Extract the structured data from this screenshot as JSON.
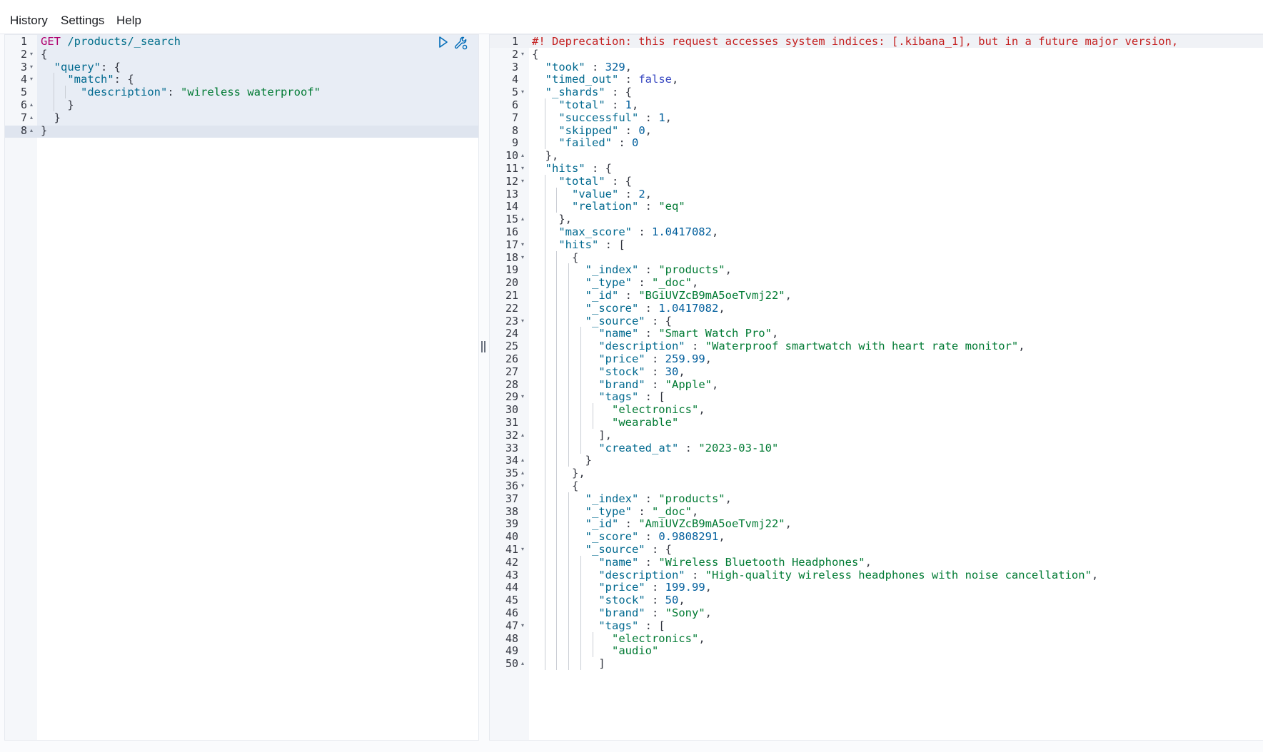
{
  "menu": {
    "history": "History",
    "settings": "Settings",
    "help": "Help"
  },
  "request": {
    "lines": [
      [
        [
          "m",
          "GET"
        ],
        [
          "p",
          " "
        ],
        [
          "u",
          "/products/_search"
        ]
      ],
      [
        [
          "p",
          "{"
        ]
      ],
      [
        [
          "p",
          "  "
        ],
        [
          "k",
          "\"query\""
        ],
        [
          "p",
          ": {"
        ]
      ],
      [
        [
          "p",
          "    "
        ],
        [
          "k",
          "\"match\""
        ],
        [
          "p",
          ": {"
        ]
      ],
      [
        [
          "p",
          "      "
        ],
        [
          "k",
          "\"description\""
        ],
        [
          "p",
          ": "
        ],
        [
          "s",
          "\"wireless waterproof\""
        ]
      ],
      [
        [
          "p",
          "    }"
        ]
      ],
      [
        [
          "p",
          "  }"
        ]
      ],
      [
        [
          "p",
          "}"
        ]
      ]
    ],
    "folds": {
      "2": "▾",
      "3": "▾",
      "4": "▾",
      "6": "▴",
      "7": "▴",
      "8": "▴"
    }
  },
  "response": {
    "lines": [
      [
        [
          "w",
          "#! Deprecation: this request accesses system indices: [.kibana_1], but in a future major version,"
        ]
      ],
      [
        [
          "p",
          "{"
        ]
      ],
      [
        [
          "p",
          "  "
        ],
        [
          "k",
          "\"took\""
        ],
        [
          "p",
          " : "
        ],
        [
          "n",
          "329"
        ],
        [
          "p",
          ","
        ]
      ],
      [
        [
          "p",
          "  "
        ],
        [
          "k",
          "\"timed_out\""
        ],
        [
          "p",
          " : "
        ],
        [
          "b",
          "false"
        ],
        [
          "p",
          ","
        ]
      ],
      [
        [
          "p",
          "  "
        ],
        [
          "k",
          "\"_shards\""
        ],
        [
          "p",
          " : {"
        ]
      ],
      [
        [
          "p",
          "    "
        ],
        [
          "k",
          "\"total\""
        ],
        [
          "p",
          " : "
        ],
        [
          "n",
          "1"
        ],
        [
          "p",
          ","
        ]
      ],
      [
        [
          "p",
          "    "
        ],
        [
          "k",
          "\"successful\""
        ],
        [
          "p",
          " : "
        ],
        [
          "n",
          "1"
        ],
        [
          "p",
          ","
        ]
      ],
      [
        [
          "p",
          "    "
        ],
        [
          "k",
          "\"skipped\""
        ],
        [
          "p",
          " : "
        ],
        [
          "n",
          "0"
        ],
        [
          "p",
          ","
        ]
      ],
      [
        [
          "p",
          "    "
        ],
        [
          "k",
          "\"failed\""
        ],
        [
          "p",
          " : "
        ],
        [
          "n",
          "0"
        ]
      ],
      [
        [
          "p",
          "  },"
        ]
      ],
      [
        [
          "p",
          "  "
        ],
        [
          "k",
          "\"hits\""
        ],
        [
          "p",
          " : {"
        ]
      ],
      [
        [
          "p",
          "    "
        ],
        [
          "k",
          "\"total\""
        ],
        [
          "p",
          " : {"
        ]
      ],
      [
        [
          "p",
          "      "
        ],
        [
          "k",
          "\"value\""
        ],
        [
          "p",
          " : "
        ],
        [
          "n",
          "2"
        ],
        [
          "p",
          ","
        ]
      ],
      [
        [
          "p",
          "      "
        ],
        [
          "k",
          "\"relation\""
        ],
        [
          "p",
          " : "
        ],
        [
          "s",
          "\"eq\""
        ]
      ],
      [
        [
          "p",
          "    },"
        ]
      ],
      [
        [
          "p",
          "    "
        ],
        [
          "k",
          "\"max_score\""
        ],
        [
          "p",
          " : "
        ],
        [
          "n",
          "1.0417082"
        ],
        [
          "p",
          ","
        ]
      ],
      [
        [
          "p",
          "    "
        ],
        [
          "k",
          "\"hits\""
        ],
        [
          "p",
          " : ["
        ]
      ],
      [
        [
          "p",
          "      {"
        ]
      ],
      [
        [
          "p",
          "        "
        ],
        [
          "k",
          "\"_index\""
        ],
        [
          "p",
          " : "
        ],
        [
          "s",
          "\"products\""
        ],
        [
          "p",
          ","
        ]
      ],
      [
        [
          "p",
          "        "
        ],
        [
          "k",
          "\"_type\""
        ],
        [
          "p",
          " : "
        ],
        [
          "s",
          "\"_doc\""
        ],
        [
          "p",
          ","
        ]
      ],
      [
        [
          "p",
          "        "
        ],
        [
          "k",
          "\"_id\""
        ],
        [
          "p",
          " : "
        ],
        [
          "s",
          "\"BGiUVZcB9mA5oeTvmj22\""
        ],
        [
          "p",
          ","
        ]
      ],
      [
        [
          "p",
          "        "
        ],
        [
          "k",
          "\"_score\""
        ],
        [
          "p",
          " : "
        ],
        [
          "n",
          "1.0417082"
        ],
        [
          "p",
          ","
        ]
      ],
      [
        [
          "p",
          "        "
        ],
        [
          "k",
          "\"_source\""
        ],
        [
          "p",
          " : {"
        ]
      ],
      [
        [
          "p",
          "          "
        ],
        [
          "k",
          "\"name\""
        ],
        [
          "p",
          " : "
        ],
        [
          "s",
          "\"Smart Watch Pro\""
        ],
        [
          "p",
          ","
        ]
      ],
      [
        [
          "p",
          "          "
        ],
        [
          "k",
          "\"description\""
        ],
        [
          "p",
          " : "
        ],
        [
          "s",
          "\"Waterproof smartwatch with heart rate monitor\""
        ],
        [
          "p",
          ","
        ]
      ],
      [
        [
          "p",
          "          "
        ],
        [
          "k",
          "\"price\""
        ],
        [
          "p",
          " : "
        ],
        [
          "n",
          "259.99"
        ],
        [
          "p",
          ","
        ]
      ],
      [
        [
          "p",
          "          "
        ],
        [
          "k",
          "\"stock\""
        ],
        [
          "p",
          " : "
        ],
        [
          "n",
          "30"
        ],
        [
          "p",
          ","
        ]
      ],
      [
        [
          "p",
          "          "
        ],
        [
          "k",
          "\"brand\""
        ],
        [
          "p",
          " : "
        ],
        [
          "s",
          "\"Apple\""
        ],
        [
          "p",
          ","
        ]
      ],
      [
        [
          "p",
          "          "
        ],
        [
          "k",
          "\"tags\""
        ],
        [
          "p",
          " : ["
        ]
      ],
      [
        [
          "p",
          "            "
        ],
        [
          "s",
          "\"electronics\""
        ],
        [
          "p",
          ","
        ]
      ],
      [
        [
          "p",
          "            "
        ],
        [
          "s",
          "\"wearable\""
        ]
      ],
      [
        [
          "p",
          "          ],"
        ]
      ],
      [
        [
          "p",
          "          "
        ],
        [
          "k",
          "\"created_at\""
        ],
        [
          "p",
          " : "
        ],
        [
          "s",
          "\"2023-03-10\""
        ]
      ],
      [
        [
          "p",
          "        }"
        ]
      ],
      [
        [
          "p",
          "      },"
        ]
      ],
      [
        [
          "p",
          "      {"
        ]
      ],
      [
        [
          "p",
          "        "
        ],
        [
          "k",
          "\"_index\""
        ],
        [
          "p",
          " : "
        ],
        [
          "s",
          "\"products\""
        ],
        [
          "p",
          ","
        ]
      ],
      [
        [
          "p",
          "        "
        ],
        [
          "k",
          "\"_type\""
        ],
        [
          "p",
          " : "
        ],
        [
          "s",
          "\"_doc\""
        ],
        [
          "p",
          ","
        ]
      ],
      [
        [
          "p",
          "        "
        ],
        [
          "k",
          "\"_id\""
        ],
        [
          "p",
          " : "
        ],
        [
          "s",
          "\"AmiUVZcB9mA5oeTvmj22\""
        ],
        [
          "p",
          ","
        ]
      ],
      [
        [
          "p",
          "        "
        ],
        [
          "k",
          "\"_score\""
        ],
        [
          "p",
          " : "
        ],
        [
          "n",
          "0.9808291"
        ],
        [
          "p",
          ","
        ]
      ],
      [
        [
          "p",
          "        "
        ],
        [
          "k",
          "\"_source\""
        ],
        [
          "p",
          " : {"
        ]
      ],
      [
        [
          "p",
          "          "
        ],
        [
          "k",
          "\"name\""
        ],
        [
          "p",
          " : "
        ],
        [
          "s",
          "\"Wireless Bluetooth Headphones\""
        ],
        [
          "p",
          ","
        ]
      ],
      [
        [
          "p",
          "          "
        ],
        [
          "k",
          "\"description\""
        ],
        [
          "p",
          " : "
        ],
        [
          "s",
          "\"High-quality wireless headphones with noise cancellation\""
        ],
        [
          "p",
          ","
        ]
      ],
      [
        [
          "p",
          "          "
        ],
        [
          "k",
          "\"price\""
        ],
        [
          "p",
          " : "
        ],
        [
          "n",
          "199.99"
        ],
        [
          "p",
          ","
        ]
      ],
      [
        [
          "p",
          "          "
        ],
        [
          "k",
          "\"stock\""
        ],
        [
          "p",
          " : "
        ],
        [
          "n",
          "50"
        ],
        [
          "p",
          ","
        ]
      ],
      [
        [
          "p",
          "          "
        ],
        [
          "k",
          "\"brand\""
        ],
        [
          "p",
          " : "
        ],
        [
          "s",
          "\"Sony\""
        ],
        [
          "p",
          ","
        ]
      ],
      [
        [
          "p",
          "          "
        ],
        [
          "k",
          "\"tags\""
        ],
        [
          "p",
          " : ["
        ]
      ],
      [
        [
          "p",
          "            "
        ],
        [
          "s",
          "\"electronics\""
        ],
        [
          "p",
          ","
        ]
      ],
      [
        [
          "p",
          "            "
        ],
        [
          "s",
          "\"audio\""
        ]
      ],
      [
        [
          "p",
          "          ]"
        ]
      ]
    ],
    "folds": {
      "2": "▾",
      "5": "▾",
      "10": "▴",
      "11": "▾",
      "12": "▾",
      "15": "▴",
      "17": "▾",
      "18": "▾",
      "23": "▾",
      "29": "▾",
      "32": "▴",
      "34": "▴",
      "35": "▴",
      "36": "▾",
      "41": "▾",
      "47": "▾",
      "50": "▴"
    }
  },
  "icons": {
    "run": "play-icon",
    "settings": "wrench-icon"
  }
}
